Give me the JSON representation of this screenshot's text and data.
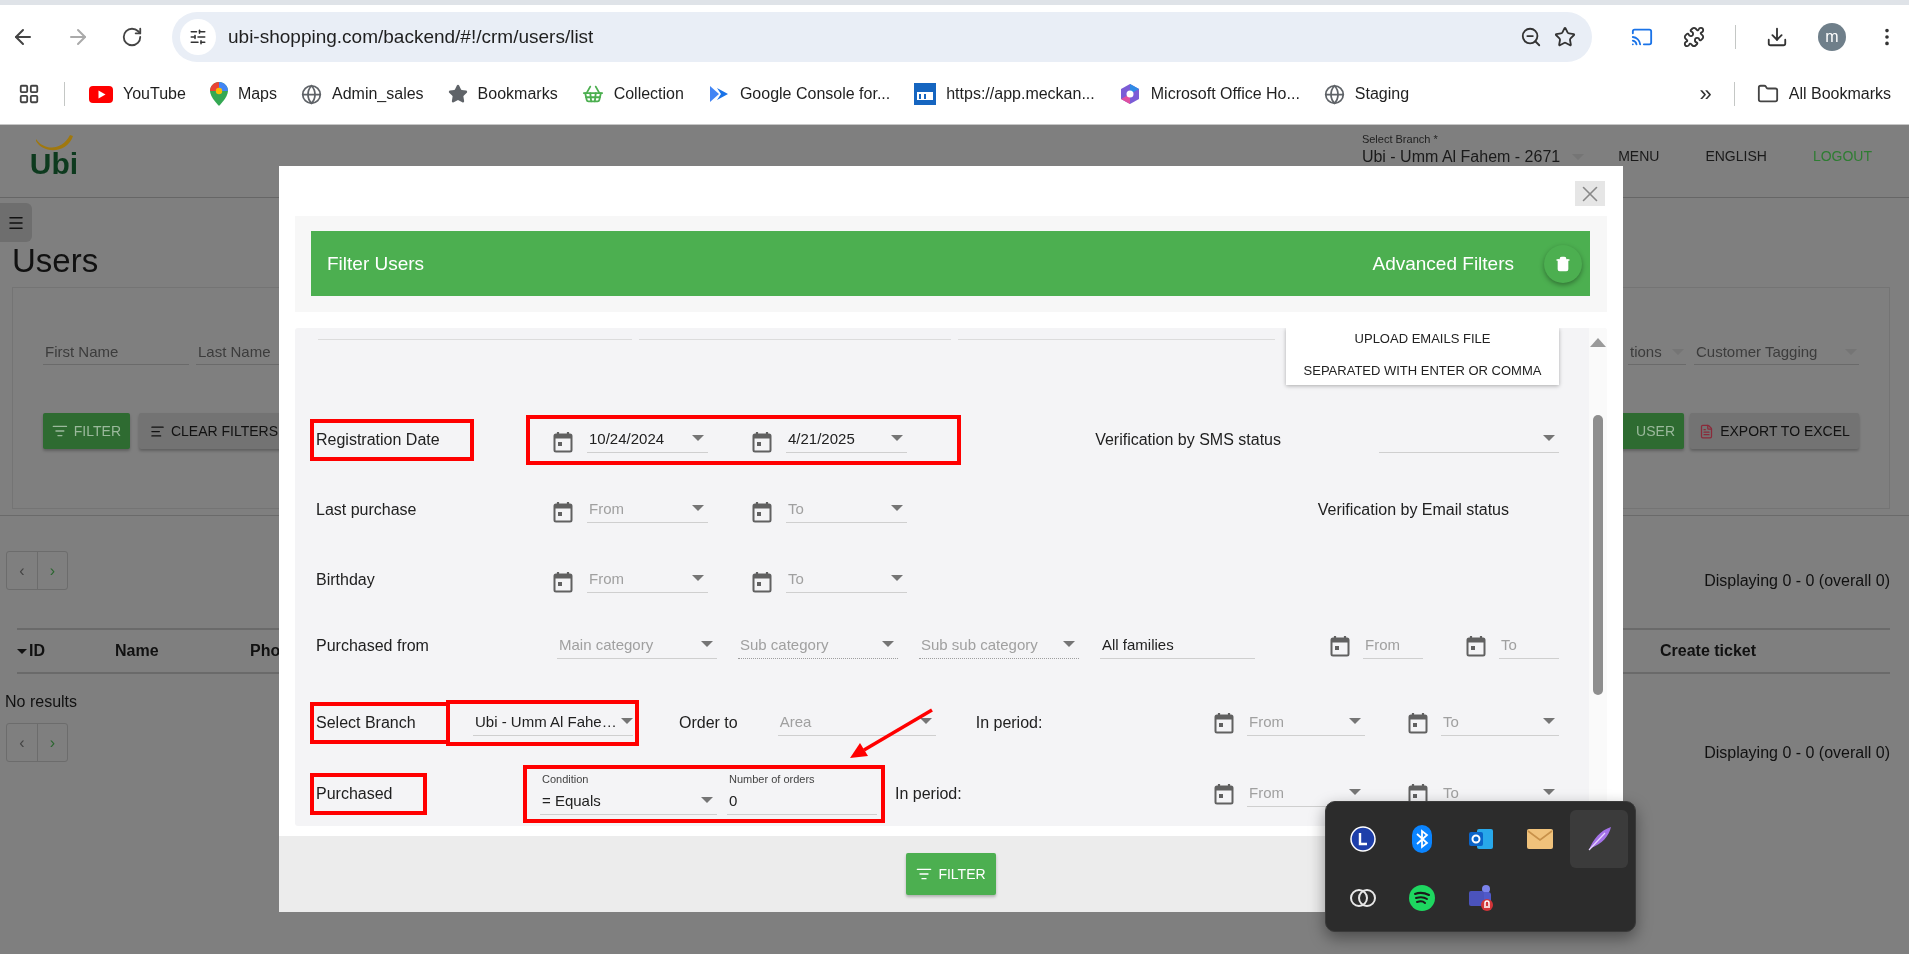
{
  "browser": {
    "url": "ubi-shopping.com/backend/#!/crm/users/list",
    "profile": "m",
    "bookmarks": [
      {
        "label": "YouTube"
      },
      {
        "label": "Maps"
      },
      {
        "label": "Admin_sales"
      },
      {
        "label": "Bookmarks"
      },
      {
        "label": "Collection"
      },
      {
        "label": "Google Console for..."
      },
      {
        "label": "https://app.meckan..."
      },
      {
        "label": "Microsoft Office Ho..."
      },
      {
        "label": "Staging"
      }
    ],
    "more": "»",
    "all_bookmarks": "All Bookmarks"
  },
  "app": {
    "logo": "Ubi",
    "branch_label": "Select Branch *",
    "branch": "Ubi - Umm Al Fahem - 2671",
    "nav": [
      {
        "label": "MENU",
        "kind": "plain"
      },
      {
        "label": "ENGLISH",
        "kind": "plain"
      },
      {
        "label": "LOGOUT",
        "kind": "accent"
      }
    ]
  },
  "page": {
    "title": "Users",
    "filters_left": [
      "First Name",
      "Last Name"
    ],
    "filters_right": [
      "tions",
      "Customer Tagging"
    ],
    "buttons_left": [
      {
        "label": "FILTER",
        "kind": "filter"
      },
      {
        "label": "CLEAR FILTERS",
        "kind": "clear"
      }
    ],
    "buttons_right": [
      {
        "label": "USER",
        "kind": "user"
      },
      {
        "label": "EXPORT TO EXCEL",
        "kind": "export"
      }
    ],
    "pagers": [
      {
        "prev": "‹",
        "next": "›",
        "summary": "Displaying 0 - 0 (overall 0)"
      },
      {
        "prev": "‹",
        "next": "›",
        "summary": "Displaying 0 - 0 (overall 0)"
      }
    ],
    "columns_left": [
      "ID",
      "Name",
      "Pho"
    ],
    "columns_right": [
      "Create ticket"
    ],
    "empty": "No results"
  },
  "modal": {
    "title": "Filter Users",
    "advanced": "Advanced Filters",
    "upload": [
      "UPLOAD EMAILS FILE",
      "SEPARATED WITH ENTER OR COMMA"
    ],
    "rows": [
      {
        "kind": "dates",
        "label": "Registration Date",
        "label_highlighted": true,
        "fields": [
          {
            "kind": "group",
            "highlighted": true,
            "items": [
              {
                "kind": "calendar"
              },
              {
                "kind": "select",
                "value": "10/24/2024"
              },
              {
                "kind": "calendar"
              },
              {
                "kind": "select",
                "value": "4/21/2025"
              }
            ]
          }
        ],
        "trailing": [
          {
            "kind": "text",
            "text": "Verification by SMS status"
          },
          {
            "kind": "select"
          }
        ]
      },
      {
        "kind": "dates",
        "label": "Last purchase",
        "label_highlighted": false,
        "fields": [
          {
            "kind": "group",
            "highlighted": false,
            "items": [
              {
                "kind": "calendar"
              },
              {
                "kind": "select",
                "placeholder": "From"
              },
              {
                "kind": "calendar"
              },
              {
                "kind": "select",
                "placeholder": "To"
              }
            ]
          }
        ],
        "trailing": [
          {
            "kind": "text",
            "text": "Verification by Email status"
          }
        ]
      },
      {
        "kind": "dates",
        "label": "Birthday",
        "label_highlighted": false,
        "fields": [
          {
            "kind": "group",
            "highlighted": false,
            "items": [
              {
                "kind": "calendar"
              },
              {
                "kind": "select",
                "placeholder": "From"
              },
              {
                "kind": "calendar"
              },
              {
                "kind": "select",
                "placeholder": "To"
              }
            ]
          }
        ],
        "trailing": []
      },
      {
        "kind": "categories",
        "label": "Purchased from",
        "label_highlighted": false,
        "fields": [
          {
            "kind": "select",
            "placeholder": "Main category",
            "disabled": false
          },
          {
            "kind": "select",
            "placeholder": "Sub category",
            "disabled": true
          },
          {
            "kind": "select",
            "placeholder": "Sub sub category",
            "disabled": true
          },
          {
            "kind": "input",
            "value": "All families",
            "disabled": false
          }
        ],
        "trailing": [
          {
            "kind": "calendar"
          },
          {
            "kind": "input",
            "placeholder": "From"
          },
          {
            "kind": "calendar"
          },
          {
            "kind": "input",
            "placeholder": "To"
          }
        ]
      },
      {
        "kind": "branch",
        "label": "Select Branch",
        "label_highlighted": true,
        "fields": [
          {
            "kind": "group",
            "highlighted": true,
            "items": [
              {
                "kind": "select",
                "value": "Ubi - Umm Al Fahe…"
              }
            ]
          },
          {
            "kind": "text",
            "text": "Order to"
          },
          {
            "kind": "select",
            "placeholder": "Area"
          },
          {
            "kind": "text",
            "text": "In period:"
          }
        ],
        "trailing": [
          {
            "kind": "calendar"
          },
          {
            "kind": "select",
            "placeholder": "From"
          },
          {
            "kind": "calendar"
          },
          {
            "kind": "select",
            "placeholder": "To"
          }
        ]
      },
      {
        "kind": "orders",
        "label": "Purchased",
        "label_highlighted": true,
        "fields": [
          {
            "kind": "group",
            "highlighted": true,
            "items": [
              {
                "kind": "select",
                "caption": "Condition",
                "value": "= Equals"
              },
              {
                "kind": "input",
                "caption": "Number of orders",
                "value": "0"
              }
            ]
          },
          {
            "kind": "text",
            "text": "In period:"
          }
        ],
        "trailing": [
          {
            "kind": "calendar"
          },
          {
            "kind": "select",
            "placeholder": "From"
          },
          {
            "kind": "calendar"
          },
          {
            "kind": "select",
            "placeholder": "To"
          }
        ]
      }
    ],
    "submit": "FILTER"
  },
  "tray": {
    "items": [
      {
        "selected": false
      },
      {
        "selected": false
      },
      {
        "selected": false
      },
      {
        "selected": false
      },
      {
        "selected": true
      },
      {
        "selected": false
      },
      {
        "selected": false
      },
      {
        "selected": false
      }
    ]
  }
}
